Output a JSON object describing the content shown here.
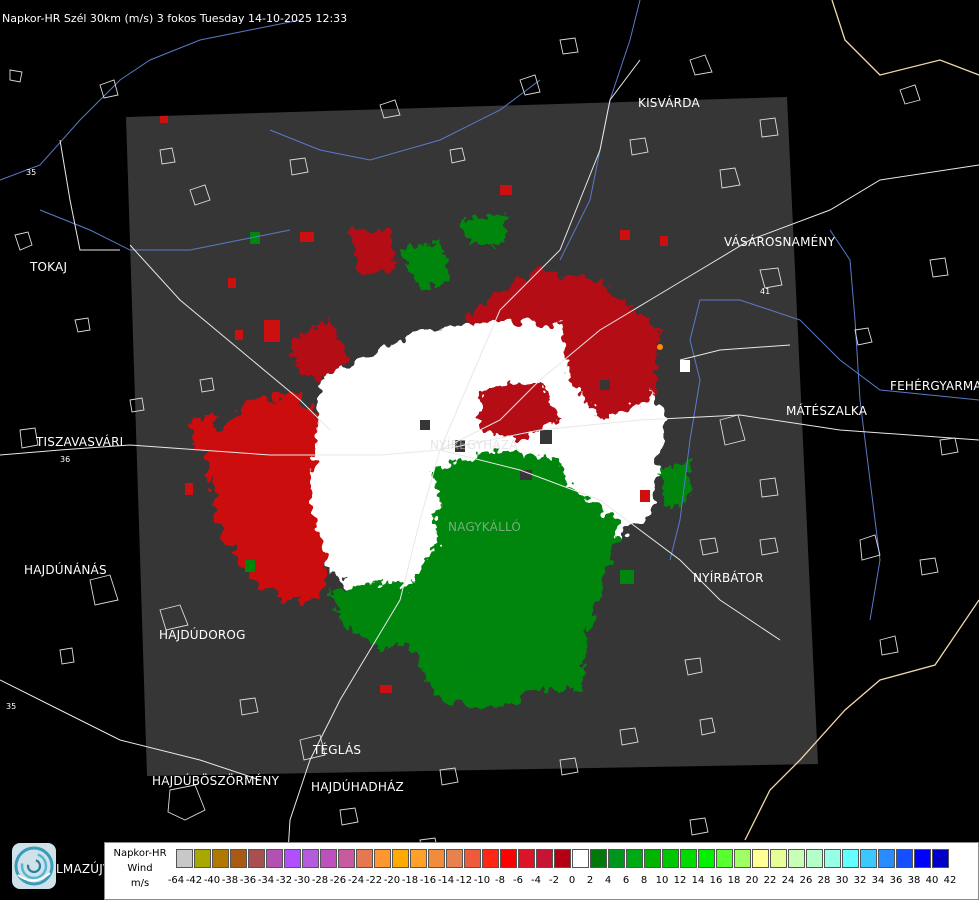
{
  "header": {
    "title": "Napkor-HR Szél 30km (m/s) 3 fokos Tuesday 14-10-2025 12:33"
  },
  "towns": [
    {
      "id": "kisvarda",
      "name": "KISVÁRDA"
    },
    {
      "id": "vasarosnameny",
      "name": "VÁSÁROSNAMÉNY"
    },
    {
      "id": "tokaj",
      "name": "TOKAJ"
    },
    {
      "id": "fehergyarmat",
      "name": "FEHÉRGYARMA"
    },
    {
      "id": "mateszalka",
      "name": "MÁTÉSZALKA"
    },
    {
      "id": "tiszavasvari",
      "name": "TISZAVASVÁRI"
    },
    {
      "id": "hajdunanas",
      "name": "HAJDÚNÁNÁS"
    },
    {
      "id": "nyirbator",
      "name": "NYÍRBÁTOR"
    },
    {
      "id": "hajdudorog",
      "name": "HAJDÚDOROG"
    },
    {
      "id": "teglas",
      "name": "TÉGLÁS"
    },
    {
      "id": "hajduboszormeny",
      "name": "HAJDÚBÖSZÖRMÉNY"
    },
    {
      "id": "hajduhadhaz",
      "name": "HAJDÚHADHÁZ"
    },
    {
      "id": "balmazujvaros",
      "name": "LMAZÚJVÁR"
    },
    {
      "id": "nyiregyhaza",
      "name": "NYÍREGYHÁZA"
    },
    {
      "id": "nagykallo",
      "name": "NAGYKÁLLÓ"
    }
  ],
  "roads": [
    {
      "id": "road-35-top",
      "name": "35"
    },
    {
      "id": "road-36",
      "name": "36"
    },
    {
      "id": "road-35-bottom",
      "name": "35"
    },
    {
      "id": "road-41",
      "name": "41"
    }
  ],
  "legend": {
    "label_line1": "Napkor-HR",
    "label_line2": "Wind",
    "label_line3": "m/s",
    "ticks": [
      "-64",
      "-42",
      "-40",
      "-38",
      "-36",
      "-34",
      "-32",
      "-30",
      "-28",
      "-26",
      "-24",
      "-22",
      "-20",
      "-18",
      "-16",
      "-14",
      "-12",
      "-10",
      "-8",
      "-6",
      "-4",
      "-2",
      "0",
      "2",
      "4",
      "6",
      "8",
      "10",
      "12",
      "14",
      "16",
      "18",
      "20",
      "22",
      "24",
      "26",
      "28",
      "30",
      "32",
      "34",
      "36",
      "38",
      "40",
      "42"
    ],
    "colors": [
      "#c8c8c8",
      "#a8a800",
      "#b07800",
      "#a85a14",
      "#a85050",
      "#b450b4",
      "#b050ff",
      "#b45adc",
      "#be50be",
      "#c85aa0",
      "#e67850",
      "#ff9632",
      "#ffaa00",
      "#ffa028",
      "#f08c3c",
      "#e68250",
      "#f05a3c",
      "#ff2814",
      "#ff0000",
      "#dc1428",
      "#c81432",
      "#b40014",
      "#ffffff",
      "#00780a",
      "#00961e",
      "#00aa14",
      "#00b400",
      "#00c800",
      "#00dc00",
      "#00f000",
      "#5aff32",
      "#a0ff64",
      "#ffff96",
      "#e6ff96",
      "#c8ffb4",
      "#b4ffc8",
      "#96ffe6",
      "#64ffff",
      "#3cc8ff",
      "#288cff",
      "#1450ff",
      "#0000ff",
      "#0000c8"
    ]
  },
  "logo": {
    "icon": "napkor-swirl-icon"
  }
}
